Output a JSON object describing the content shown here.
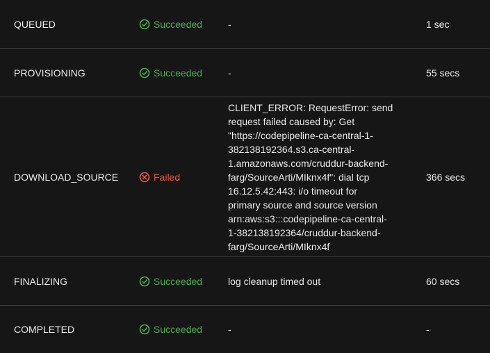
{
  "colors": {
    "background": "#161616",
    "divider": "#3d3d3d",
    "text": "#e9e9e9",
    "success": "#4aae4f",
    "failure": "#f0543a"
  },
  "phases": [
    {
      "phase": "QUEUED",
      "status": "Succeeded",
      "status_icon": "check-circle-icon",
      "context": "-",
      "duration": "1 sec"
    },
    {
      "phase": "PROVISIONING",
      "status": "Succeeded",
      "status_icon": "check-circle-icon",
      "context": "-",
      "duration": "55 secs"
    },
    {
      "phase": "DOWNLOAD_SOURCE",
      "status": "Failed",
      "status_icon": "x-circle-icon",
      "context": "CLIENT_ERROR: RequestError: send\nrequest failed caused by: Get\n\"https://codepipeline-ca-central-1-\n382138192364.s3.ca-central-\n1.amazonaws.com/cruddur-backend-\nfarg/SourceArti/MIknx4f\": dial tcp\n16.12.5.42:443: i/o timeout for\nprimary source and source version\narn:aws:s3:::codepipeline-ca-central-\n1-382138192364/cruddur-backend-\nfarg/SourceArti/MIknx4f",
      "duration": "366 secs"
    },
    {
      "phase": "FINALIZING",
      "status": "Succeeded",
      "status_icon": "check-circle-icon",
      "context": "log cleanup timed out",
      "duration": "60 secs"
    },
    {
      "phase": "COMPLETED",
      "status": "Succeeded",
      "status_icon": "check-circle-icon",
      "context": "-",
      "duration": "-"
    }
  ]
}
